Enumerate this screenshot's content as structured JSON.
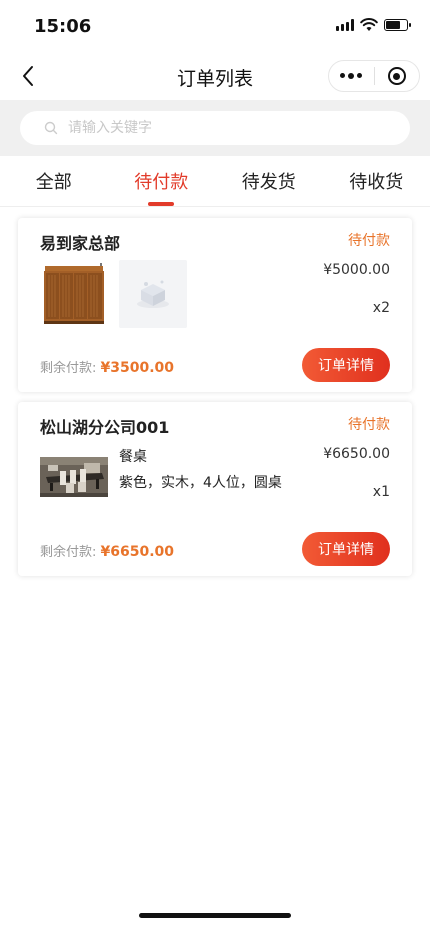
{
  "status_bar": {
    "time": "15:06"
  },
  "nav": {
    "title": "订单列表"
  },
  "search": {
    "placeholder": "请输入关键字"
  },
  "tabs": [
    {
      "label": "全部",
      "active": false
    },
    {
      "label": "待付款",
      "active": true
    },
    {
      "label": "待发货",
      "active": false
    },
    {
      "label": "待收货",
      "active": false
    }
  ],
  "orders": [
    {
      "shop": "易到家总部",
      "status": "待付款",
      "price": "¥5000.00",
      "quantity": "x2",
      "remaining_label": "剩余付款:",
      "remaining_amount": "¥3500.00",
      "detail_button": "订单详情",
      "images": [
        "wooden-cabinet",
        "placeholder-box"
      ]
    },
    {
      "shop": "松山湖分公司001",
      "status": "待付款",
      "product_name": "餐桌",
      "product_spec": "紫色，实木，4人位，圆桌",
      "price": "¥6650.00",
      "quantity": "x1",
      "remaining_label": "剩余付款:",
      "remaining_amount": "¥6650.00",
      "detail_button": "订单详情",
      "images": [
        "dining-table"
      ]
    }
  ],
  "colors": {
    "accent": "#e23b2a",
    "status_orange": "#e8742b",
    "button_gradient_start": "#f25a35",
    "button_gradient_end": "#e0301e"
  }
}
